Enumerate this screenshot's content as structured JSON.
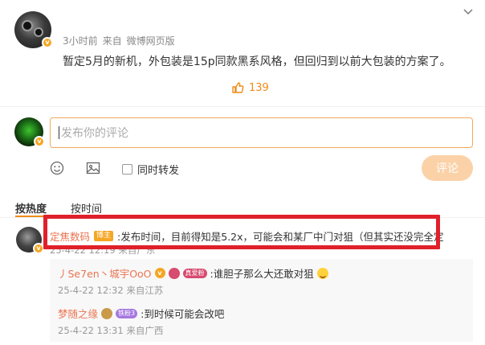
{
  "post": {
    "time": "3小时前",
    "source_label": "来自",
    "source": "微博网页版",
    "text": "暂定5月的新机，外包装是15p同款黑系风格，但回归到以前大包装的方案了。",
    "like_count": "139"
  },
  "compose": {
    "placeholder": "发布你的评论",
    "repost_label": "同时转发",
    "submit_label": "评论"
  },
  "sort": {
    "hot_label": "按热度",
    "time_label": "按时间"
  },
  "comment": {
    "user": "定焦数码",
    "tag": "博主",
    "text": ":发布时间，目前得知是5.2x，可能会和某厂中门对狙（但其实还没完全定",
    "meta": "25-4-22 12:19 来自广东"
  },
  "replies": [
    {
      "user": "丿Se7en丶城宇OoO",
      "tag": "真爱粉",
      "text": ":谁胆子那么大还敢对狙",
      "meta": "25-4-22 12:32 来自江苏"
    },
    {
      "user": "梦随之缘",
      "tag": "铁粉3",
      "text": ":到时候可能会改吧",
      "meta": "25-4-22 13:31 来自广西"
    }
  ],
  "colors": {
    "accent": "#f08a18",
    "username": "#eb7350",
    "highlight": "#e0202a",
    "submit_disabled": "#fbd2a8"
  }
}
